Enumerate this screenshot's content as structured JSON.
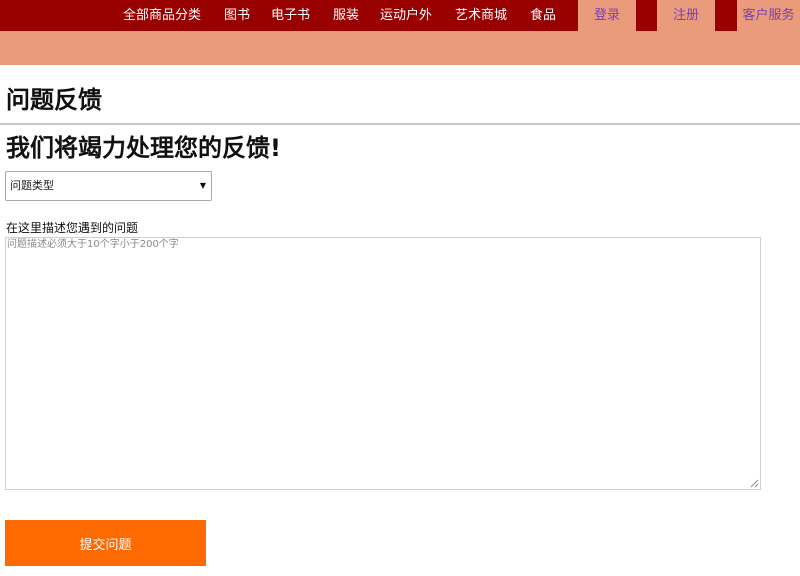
{
  "nav": {
    "items": [
      {
        "label": "全部商品分类"
      },
      {
        "label": "图书"
      },
      {
        "label": "电子书"
      },
      {
        "label": "服装"
      },
      {
        "label": "运动户外"
      },
      {
        "label": "艺术商城"
      },
      {
        "label": "食品"
      }
    ],
    "login_label": "登录",
    "register_label": "注册",
    "service_label": "客户服务"
  },
  "page": {
    "title": "问题反馈",
    "headline": "我们将竭力处理您的反馈!"
  },
  "form": {
    "issue_type": {
      "selected": "问题类型",
      "options": [
        "问题类型"
      ]
    },
    "description": {
      "label": "在这里描述您遇到的问题",
      "value": "",
      "placeholder": "问题描述必须大于10个字小于200个字"
    },
    "submit_label": "提交问题"
  },
  "colors": {
    "nav_bg": "#990000",
    "accent_bar": "#ea9b7b",
    "nav_button_text": "#7a3fb4",
    "submit_bg": "#ff6a00",
    "submit_text": "#ffffff"
  }
}
